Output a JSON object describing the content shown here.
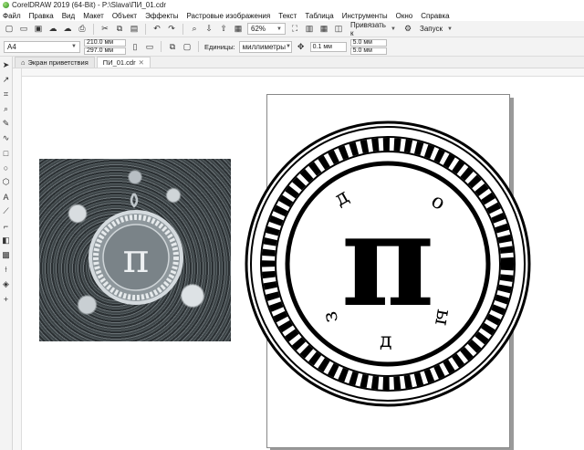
{
  "window": {
    "title": "CorelDRAW 2019 (64-Bit) - P:\\Slava\\ПИ_01.cdr"
  },
  "menu": [
    "Файл",
    "Правка",
    "Вид",
    "Макет",
    "Объект",
    "Эффекты",
    "Растровые изображения",
    "Текст",
    "Таблица",
    "Инструменты",
    "Окно",
    "Справка"
  ],
  "toolbar": {
    "zoom": "62%",
    "snap_label": "Привязать к",
    "launch_label": "Запуск"
  },
  "properties": {
    "page_size": "A4",
    "width": "210.0 мм",
    "height": "297.0 мм",
    "units_label": "Единицы:",
    "units": "миллиметры",
    "nudge": "0.1 мм",
    "dup_x": "5.0 мм",
    "dup_y": "5.0 мм"
  },
  "tabs": [
    {
      "label": "Экран приветствия"
    },
    {
      "label": "ПИ_01.cdr"
    }
  ],
  "artwork": {
    "symbol": "π",
    "letters": [
      "д",
      "о",
      "ы",
      "д",
      "з"
    ]
  }
}
